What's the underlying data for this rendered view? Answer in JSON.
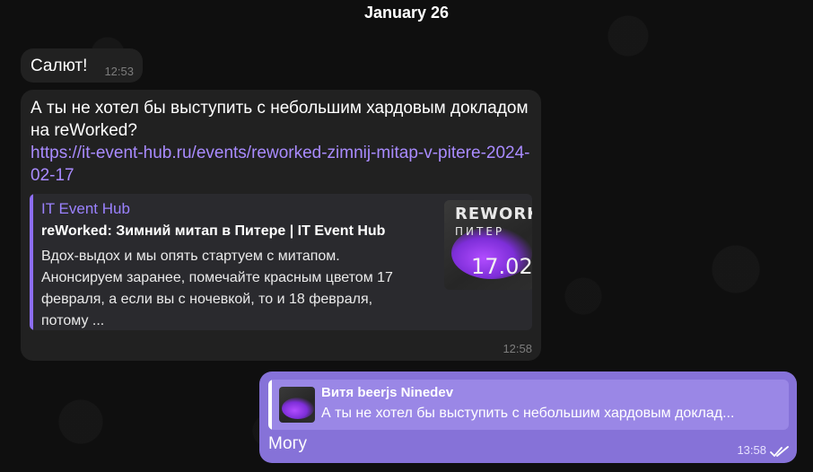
{
  "chat": {
    "date_separator": "January 26",
    "messages": [
      {
        "id": "m1",
        "direction": "incoming",
        "text": "Салют!",
        "time": "12:53"
      },
      {
        "id": "m2",
        "direction": "incoming",
        "text": "А ты не хотел бы выступить с небольшим хардовым докладом на reWorked?",
        "link": "https://it-event-hub.ru/events/reworked-zimnij-mitap-v-pitere-2024-02-17",
        "preview": {
          "site_name": "IT Event Hub",
          "title": "reWorked: Зимний митап в Питере | IT Event Hub",
          "description": "Вдох-выдох и мы опять стартуем с митапом. Анонсируем заранее, помечайте красным цветом 17 февраля, а если вы с ночевкой, то и 18 февраля, потому ...",
          "thumbnail": {
            "line1": "REWORKED",
            "line2": "ПИТЕР",
            "line3": "17.02"
          }
        },
        "time": "12:58"
      },
      {
        "id": "m3",
        "direction": "outgoing",
        "reply": {
          "author": "Витя beerjs Ninedev",
          "quote": "А ты не хотел бы выступить с небольшим хардовым доклад..."
        },
        "text": "Могу",
        "time": "13:58",
        "status_icon": "double-check-icon"
      }
    ]
  },
  "colors": {
    "background": "#0f0f0f",
    "incoming_bubble": "#212121",
    "outgoing_bubble": "#8672d8",
    "link": "#a98bff",
    "accent": "#8d6ef5"
  }
}
